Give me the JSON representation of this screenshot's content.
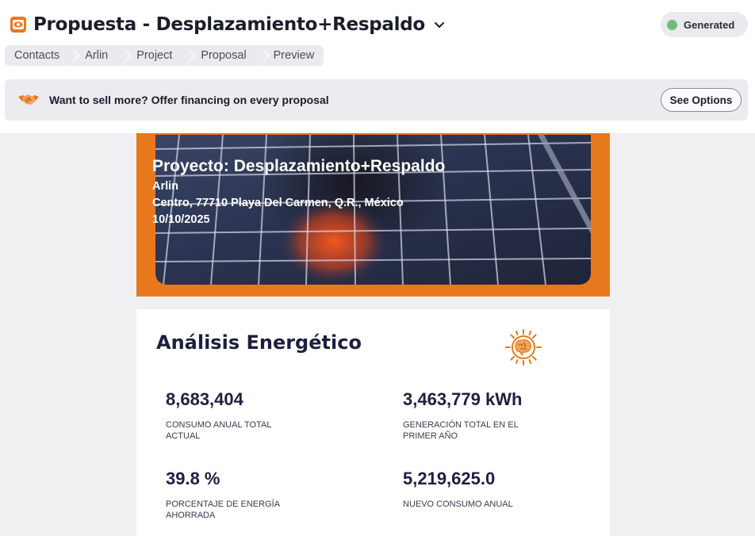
{
  "header": {
    "title": "Propuesta - Desplazamiento+Respaldo",
    "status": "Generated",
    "colors": {
      "accent": "#e8781e",
      "status": "#6cbf7a",
      "navy": "#1d1f40"
    }
  },
  "breadcrumb": [
    "Contacts",
    "Arlin",
    "Project",
    "Proposal",
    "Preview"
  ],
  "promo": {
    "text": "Want to sell more? Offer financing on every proposal",
    "button": "See Options"
  },
  "hero": {
    "title": "Proyecto: Desplazamiento+Respaldo",
    "client": "Arlin",
    "address": "Centro, 77710 Playa Del Carmen, Q.R., México",
    "date": "10/10/2025"
  },
  "analysis": {
    "title": "Análisis Energético",
    "metrics": [
      {
        "value": "8,683,404",
        "label": "Consumo anual total actual"
      },
      {
        "value": "3,463,779 kWh",
        "label": "Generación total en el primer año"
      },
      {
        "value": "39.8 %",
        "label": "Porcentaje de energía ahorrada"
      },
      {
        "value": "5,219,625.0",
        "label": "Nuevo consumo anual"
      }
    ]
  }
}
